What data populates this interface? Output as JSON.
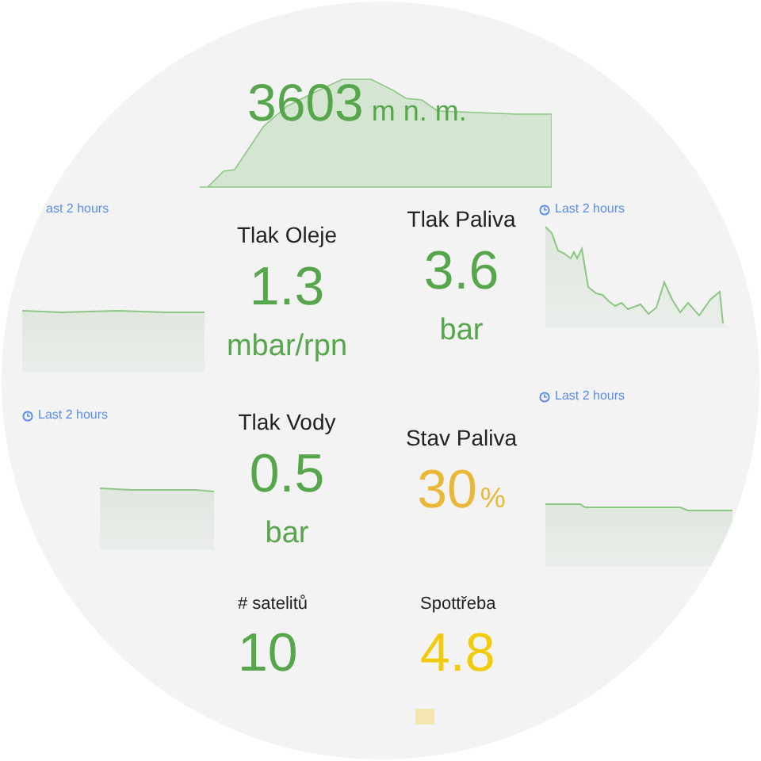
{
  "altitude": {
    "value": "3603",
    "unit": "m n. m.",
    "color": "#56a64b"
  },
  "left_panels": [
    {
      "time_range": "ast 2 hours",
      "icon": false
    },
    {
      "time_range": "Last 2 hours",
      "icon": true
    }
  ],
  "right_panels": [
    {
      "time_range": "Last 2 hours",
      "icon": true
    },
    {
      "time_range": "Last 2 hours",
      "icon": true
    }
  ],
  "stats": [
    {
      "label": "Tlak Oleje",
      "value": "1.3",
      "unit": "mbar/rpn",
      "kind": "below",
      "color": "#56a64b"
    },
    {
      "label": "Tlak Paliva",
      "value": "3.6",
      "unit": "bar",
      "kind": "below",
      "color": "#56a64b"
    },
    {
      "label": "Tlak Vody",
      "value": "0.5",
      "unit": "bar",
      "kind": "below",
      "color": "#56a64b"
    },
    {
      "label": "Stav Paliva",
      "value": "30",
      "unit": "%",
      "kind": "inline",
      "color": "#eab839"
    },
    {
      "label": "# satelitů",
      "value": "10",
      "kind": "left",
      "color": "#56a64b"
    },
    {
      "label": "Spottřeba",
      "value": "4.8",
      "kind": "left",
      "color": "#f2cc0c"
    }
  ]
}
